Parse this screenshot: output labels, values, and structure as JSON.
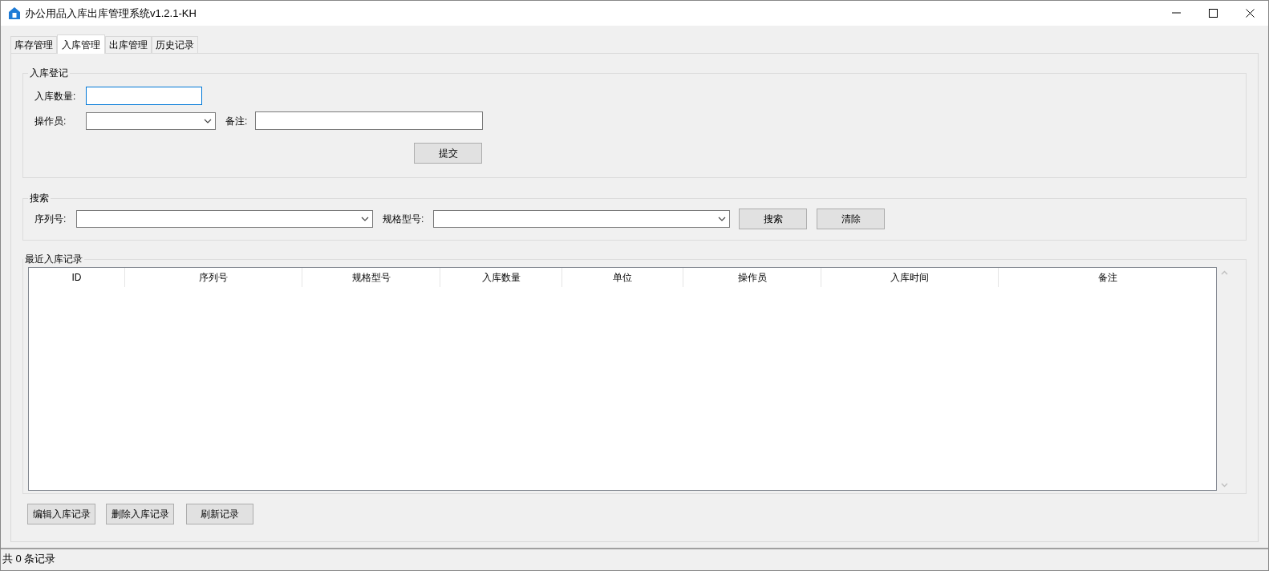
{
  "window": {
    "title": "办公用品入库出库管理系统v1.2.1-KH"
  },
  "tabs": [
    {
      "label": "库存管理",
      "selected": false
    },
    {
      "label": "入库管理",
      "selected": true
    },
    {
      "label": "出库管理",
      "selected": false
    },
    {
      "label": "历史记录",
      "selected": false
    }
  ],
  "registration": {
    "title": "入库登记",
    "quantity_label": "入库数量:",
    "quantity_focused": true,
    "operator_label": "操作员:",
    "remark_label": "备注:",
    "submit": "提交"
  },
  "search": {
    "title": "搜索",
    "serial_label": "序列号:",
    "model_label": "规格型号:",
    "buttons": [
      "搜索",
      "清除"
    ]
  },
  "records": {
    "title": "最近入库记录",
    "table": {
      "columns": [
        "ID",
        "序列号",
        "规格型号",
        "入库数量",
        "单位",
        "操作员",
        "入库时间",
        "备注"
      ]
    }
  },
  "buttons": [
    "编辑入库记录",
    "删除入库记录",
    "刷新记录"
  ],
  "status_bar": "共 0 条记录"
}
